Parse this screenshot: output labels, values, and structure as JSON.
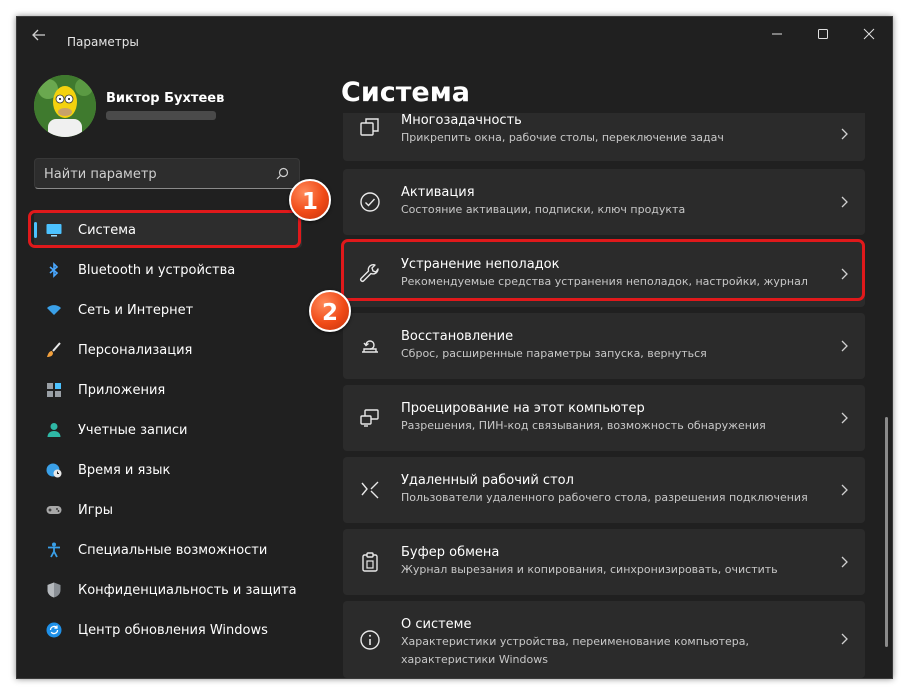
{
  "window": {
    "title": "Параметры"
  },
  "profile": {
    "name": "Виктор Бухтеев"
  },
  "search": {
    "placeholder": "Найти параметр"
  },
  "sidebar": {
    "items": [
      {
        "label": "Система",
        "icon": "monitor-icon",
        "active": true
      },
      {
        "label": "Bluetooth и устройства",
        "icon": "bluetooth-icon"
      },
      {
        "label": "Сеть и Интернет",
        "icon": "wifi-icon"
      },
      {
        "label": "Персонализация",
        "icon": "brush-icon"
      },
      {
        "label": "Приложения",
        "icon": "apps-icon"
      },
      {
        "label": "Учетные записи",
        "icon": "person-icon"
      },
      {
        "label": "Время и язык",
        "icon": "globe-clock-icon"
      },
      {
        "label": "Игры",
        "icon": "gamepad-icon"
      },
      {
        "label": "Специальные возможности",
        "icon": "accessibility-icon"
      },
      {
        "label": "Конфиденциальность и защита",
        "icon": "shield-icon"
      },
      {
        "label": "Центр обновления Windows",
        "icon": "update-icon"
      }
    ]
  },
  "main": {
    "title": "Система",
    "cards": [
      {
        "title": "Многозадачность",
        "subtitle": "Прикрепить окна, рабочие столы, переключение задач",
        "icon": "multitasking-icon"
      },
      {
        "title": "Активация",
        "subtitle": "Состояние активации, подписки, ключ продукта",
        "icon": "check-circle-icon"
      },
      {
        "title": "Устранение неполадок",
        "subtitle": "Рекомендуемые средства устранения неполадок, настройки, журнал",
        "icon": "wrench-icon"
      },
      {
        "title": "Восстановление",
        "subtitle": "Сброс, расширенные параметры запуска, вернуться",
        "icon": "recovery-icon"
      },
      {
        "title": "Проецирование на этот компьютер",
        "subtitle": "Разрешения, ПИН-код связывания, возможность обнаружения",
        "icon": "projection-icon"
      },
      {
        "title": "Удаленный рабочий стол",
        "subtitle": "Пользователи удаленного рабочего стола, разрешения подключения",
        "icon": "remote-desktop-icon"
      },
      {
        "title": "Буфер обмена",
        "subtitle": "Журнал вырезания и копирования, синхронизировать, очистить",
        "icon": "clipboard-icon"
      },
      {
        "title": "О системе",
        "subtitle": "Характеристики устройства, переименование компьютера, характеристики Windows",
        "icon": "info-icon"
      }
    ]
  },
  "annotations": {
    "badge1": "1",
    "badge2": "2",
    "color": "#e0191b"
  },
  "colors": {
    "accent": "#4cc2ff",
    "window_bg": "#202020",
    "card_bg": "#2b2b2b"
  }
}
